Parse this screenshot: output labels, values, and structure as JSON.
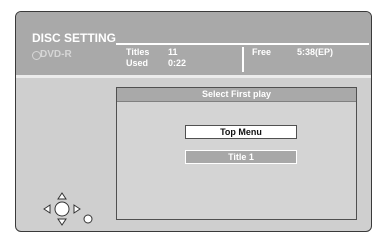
{
  "header": {
    "title": "DISC SETTING",
    "disc_type": "DVD-R",
    "titles_label": "Titles",
    "titles_value": "11",
    "used_label": "Used",
    "used_value": "0:22",
    "free_label": "Free",
    "free_value": "5:38(EP)"
  },
  "dialog": {
    "title": "Select First play",
    "options": [
      {
        "label": "Top Menu",
        "selected": true
      },
      {
        "label": "Title 1",
        "selected": false
      }
    ]
  },
  "icons": [
    "disc-icon",
    "dpad-icon",
    "return-button-icon"
  ]
}
